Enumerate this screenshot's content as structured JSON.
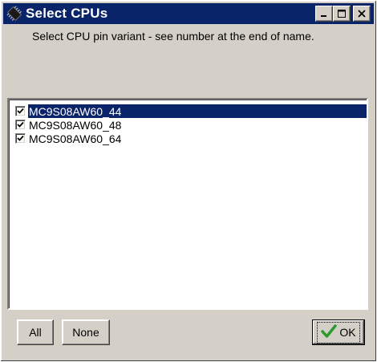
{
  "window": {
    "title": "Select CPUs",
    "icon": "chip-icon",
    "controls": [
      "minimize-icon",
      "maximize-icon",
      "close-icon"
    ]
  },
  "instruction": "Select CPU pin variant - see number at the end of name.",
  "cpu_list": {
    "items": [
      {
        "label": "MC9S08AW60_44",
        "checked": true,
        "selected": true
      },
      {
        "label": "MC9S08AW60_48",
        "checked": true,
        "selected": false
      },
      {
        "label": "MC9S08AW60_64",
        "checked": true,
        "selected": false
      }
    ]
  },
  "buttons": {
    "all_label": "All",
    "none_label": "None",
    "ok_label": "OK",
    "ok_icon": "checkmark-icon"
  },
  "colors": {
    "titlebar": "#0a246a",
    "face": "#d4d0c8",
    "selection": "#0a246a",
    "ok_check": "#2e9a2e"
  }
}
